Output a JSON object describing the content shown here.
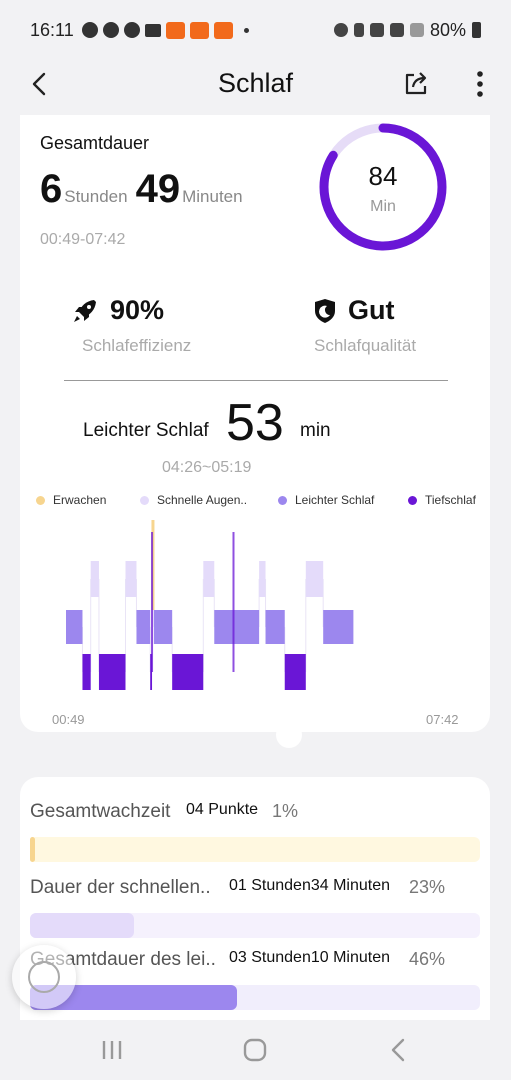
{
  "status_bar": {
    "time": "16:11",
    "battery": "80%",
    "icons": [
      "dnd-icon",
      "facebook-icon",
      "facebook-icon",
      "mail-icon",
      "temu-icon",
      "temu-icon",
      "temu-icon",
      "dot-icon",
      "alarm-icon",
      "bluetooth-icon",
      "wifi-icon",
      "wifi-call-icon",
      "signal-icon",
      "battery-icon"
    ]
  },
  "app_bar": {
    "title": "Schlaf",
    "back_icon": "back-arrow-icon",
    "share_icon": "share-icon",
    "more_icon": "more-vertical-icon"
  },
  "summary": {
    "label": "Gesamtdauer",
    "hours": "6",
    "hours_unit": "Stunden",
    "minutes": "49",
    "minutes_unit": "Minuten",
    "range": "00:49-07:42",
    "score": "84",
    "score_unit": "Min",
    "score_fraction": 0.84,
    "accent_color": "#6a16d6",
    "ring_track_color": "#e6dcf7"
  },
  "stats": {
    "efficiency_value": "90%",
    "efficiency_label": "Schlafeffizienz",
    "efficiency_icon": "rocket-icon",
    "quality_value": "Gut",
    "quality_label": "Schlafqualität",
    "quality_icon": "shield-moon-icon"
  },
  "selected_segment": {
    "label": "Leichter Schlaf",
    "minutes": "53",
    "unit": "min",
    "range": "04:26~05:19"
  },
  "chart_data": {
    "type": "hypnogram",
    "legend": [
      {
        "name": "Erwachen",
        "color": "#f7d58f"
      },
      {
        "name": "Schnelle Augen..",
        "color": "#e4dbfa"
      },
      {
        "name": "Leichter Schlaf",
        "color": "#9c87ee"
      },
      {
        "name": "Tiefschlaf",
        "color": "#6a16d6"
      }
    ],
    "x_start": "00:49",
    "x_end": "07:42",
    "start_minute": 0,
    "end_minute": 413,
    "stages": [
      "Erwachen",
      "Schnelle Augen..",
      "Leichter Schlaf",
      "Tiefschlaf"
    ],
    "segments": [
      {
        "stage": 2,
        "start": 0,
        "end": 18
      },
      {
        "stage": 3,
        "start": 18,
        "end": 27
      },
      {
        "stage": 1,
        "start": 27,
        "end": 36
      },
      {
        "stage": 3,
        "start": 36,
        "end": 65
      },
      {
        "stage": 1,
        "start": 65,
        "end": 77
      },
      {
        "stage": 2,
        "start": 77,
        "end": 92
      },
      {
        "stage": 3,
        "start": 92,
        "end": 94
      },
      {
        "stage": 0,
        "start": 94,
        "end": 96
      },
      {
        "stage": 2,
        "start": 96,
        "end": 116
      },
      {
        "stage": 3,
        "start": 116,
        "end": 150
      },
      {
        "stage": 1,
        "start": 150,
        "end": 162
      },
      {
        "stage": 2,
        "start": 162,
        "end": 211
      },
      {
        "stage": 1,
        "start": 211,
        "end": 218
      },
      {
        "stage": 2,
        "start": 218,
        "end": 239
      },
      {
        "stage": 3,
        "start": 239,
        "end": 262
      },
      {
        "stage": 1,
        "start": 262,
        "end": 281
      },
      {
        "stage": 2,
        "start": 281,
        "end": 314
      }
    ],
    "spikes": [
      {
        "stage": 0,
        "minute": 95
      },
      {
        "stage": 3,
        "minute": 94
      },
      {
        "stage": 3,
        "minute": 183
      }
    ]
  },
  "breakdown": {
    "rows": [
      {
        "name": "Gesamtwachzeit",
        "value": "04 Punkte",
        "percent": "1%",
        "fraction": 0.01,
        "track": "#fff8e0",
        "fill": "#f7d58f"
      },
      {
        "name": "Dauer der schnellen..",
        "value": "01 Stunden34 Minuten",
        "percent": "23%",
        "fraction": 0.23,
        "track": "#f5f1fd",
        "fill": "#e4dbfa"
      },
      {
        "name": "Gesamtdauer des lei..",
        "value": "03 Stunden10 Minuten",
        "percent": "46%",
        "fraction": 0.46,
        "track": "#f1eefc",
        "fill": "#9c87ee"
      }
    ]
  },
  "nav_bar": {
    "recents_icon": "recents-icon",
    "home_icon": "home-icon",
    "back_icon": "nav-back-icon"
  },
  "assistive": {
    "icon": "assistive-touch-icon"
  }
}
